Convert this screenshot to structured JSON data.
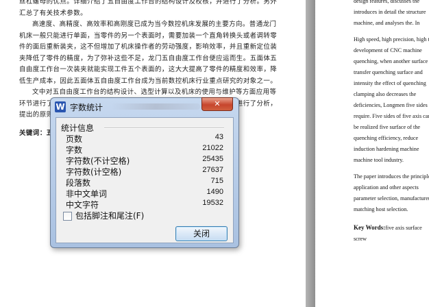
{
  "document": {
    "zh_paragraphs": [
      "丝杠螺母的优点。详细介绍了五自由度工作台的结构设计及校核，并进行了分析。另外汇总了有关技术参数。",
      "高速度、高精度、高效率和高刚度已成为当今数控机床发展的主要方向。普通龙门机床一般只能进行单面，当零件的另一个表面时，需要加装一个直角转换头或者调转零件的面后重新装夹，这不但增加了机床操作者的劳动强度，影响效率，并且重新定位装夹降低了零件的精度，为了弥补这些不足，龙门五自由度工作台便应运而生。五面体五自由度工作台一次装夹就能实现工件五个表面的，这大大提高了零件的精度和效率，降低生产成本，因此五面体五自由度工作台成为当前数控机床行业重点研究的对象之一。",
      "文中对五自由度工作台的结构设计、选型计算以及机床的使用与维护等方面应用等环节进行了介绍，并对五自由度工作台的结构、使用的机床和工作原理等进行了分析，提出的原则以及厂家的选择。"
    ],
    "zh_keywords_label": "关键词：五自由度工作台，丝杠螺母，数控机床",
    "en_paragraphs": [
      "design features, discusses the introduces in detail the structure machine, and analyses the. In",
      "High speed, high precision, high the development of CNC machine quenching, when another surface transfer quenching surface and intensity the effect of quenching clamping also decreases the deficiencies, Longmen five sides require. Five sides of five axis can be realized five surface of the quenching efficiency, reduce induction hardening machine machine tool industry.",
      "The paper introduces the principle application and other aspects parameter selection, manufacturer matching host selection."
    ],
    "en_keywords_label": "Key Words:",
    "en_keywords_value": "five axis surface screw"
  },
  "dialog": {
    "app_icon": "W",
    "title": "字数统计",
    "close_glyph": "✕",
    "group_label": "统计信息",
    "stats": [
      {
        "label": "页数",
        "value": "43"
      },
      {
        "label": "字数",
        "value": "21022"
      },
      {
        "label": "字符数(不计空格)",
        "value": "25435"
      },
      {
        "label": "字符数(计空格)",
        "value": "27637"
      },
      {
        "label": "段落数",
        "value": "715"
      },
      {
        "label": "非中文单词",
        "value": "1490"
      },
      {
        "label": "中文字符",
        "value": "19532"
      }
    ],
    "checkbox_label": "包括脚注和尾注(F)",
    "close_button": "关闭"
  }
}
